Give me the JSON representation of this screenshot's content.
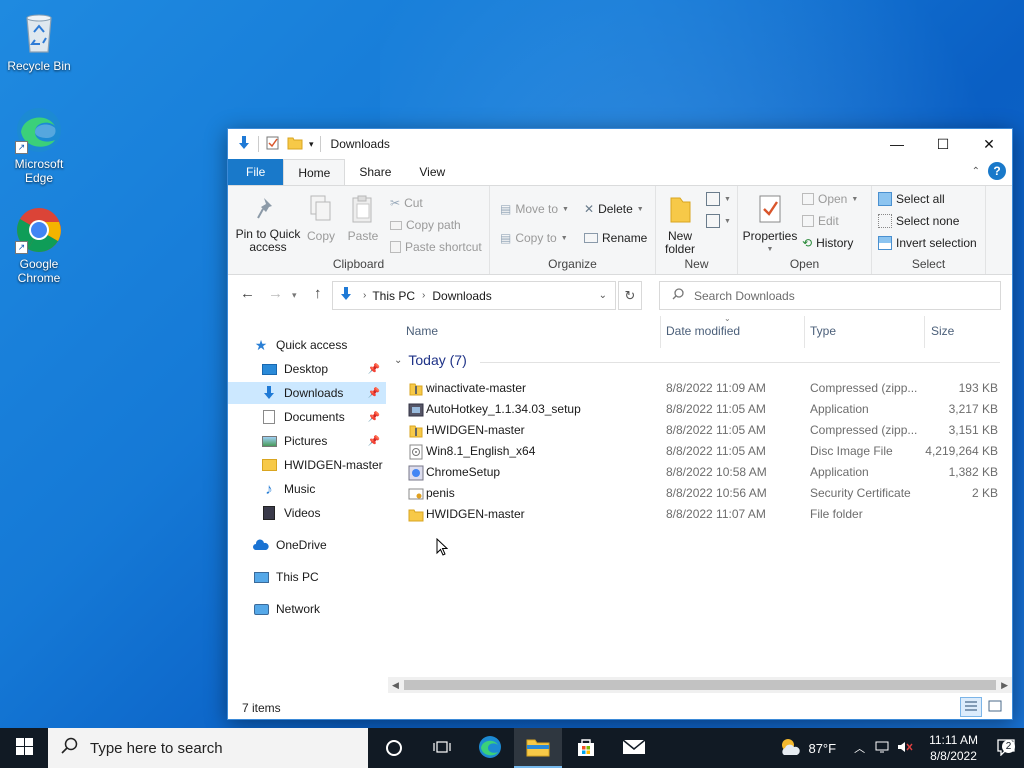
{
  "desktop": {
    "icons": [
      {
        "label": "Recycle Bin"
      },
      {
        "label": "Microsoft Edge"
      },
      {
        "label": "Google Chrome"
      }
    ]
  },
  "window": {
    "title": "Downloads",
    "tabs": {
      "file": "File",
      "home": "Home",
      "share": "Share",
      "view": "View"
    },
    "ribbon": {
      "clipboard": {
        "label": "Clipboard",
        "pin": "Pin to Quick access",
        "copy": "Copy",
        "paste": "Paste",
        "cut": "Cut",
        "copy_path": "Copy path",
        "paste_shortcut": "Paste shortcut"
      },
      "organize": {
        "label": "Organize",
        "move_to": "Move to",
        "copy_to": "Copy to",
        "delete": "Delete",
        "rename": "Rename"
      },
      "new": {
        "label": "New",
        "new_folder": "New folder"
      },
      "open": {
        "label": "Open",
        "properties": "Properties",
        "open": "Open",
        "edit": "Edit",
        "history": "History"
      },
      "select": {
        "label": "Select",
        "select_all": "Select all",
        "select_none": "Select none",
        "invert": "Invert selection"
      }
    },
    "address": {
      "this_pc": "This PC",
      "downloads": "Downloads"
    },
    "search": {
      "placeholder": "Search Downloads"
    },
    "nav": {
      "quick_access": "Quick access",
      "desktop": "Desktop",
      "downloads": "Downloads",
      "documents": "Documents",
      "pictures": "Pictures",
      "hwidgen": "HWIDGEN-master",
      "music": "Music",
      "videos": "Videos",
      "onedrive": "OneDrive",
      "this_pc": "This PC",
      "network": "Network"
    },
    "columns": {
      "name": "Name",
      "date": "Date modified",
      "type": "Type",
      "size": "Size"
    },
    "group": "Today (7)",
    "files": [
      {
        "name": "winactivate-master",
        "date": "8/8/2022 11:09 AM",
        "type": "Compressed (zipp...",
        "size": "193 KB",
        "icon": "zip-icon"
      },
      {
        "name": "AutoHotkey_1.1.34.03_setup",
        "date": "8/8/2022 11:05 AM",
        "type": "Application",
        "size": "3,217 KB",
        "icon": "app-icon"
      },
      {
        "name": "HWIDGEN-master",
        "date": "8/8/2022 11:05 AM",
        "type": "Compressed (zipp...",
        "size": "3,151 KB",
        "icon": "zip-icon"
      },
      {
        "name": "Win8.1_English_x64",
        "date": "8/8/2022 11:05 AM",
        "type": "Disc Image File",
        "size": "4,219,264 KB",
        "icon": "disc-icon"
      },
      {
        "name": "ChromeSetup",
        "date": "8/8/2022 10:58 AM",
        "type": "Application",
        "size": "1,382 KB",
        "icon": "setup-icon"
      },
      {
        "name": "penis",
        "date": "8/8/2022 10:56 AM",
        "type": "Security Certificate",
        "size": "2 KB",
        "icon": "certificate-icon"
      },
      {
        "name": "HWIDGEN-master",
        "date": "8/8/2022 11:07 AM",
        "type": "File folder",
        "size": "",
        "icon": "folder-icon"
      }
    ],
    "status": "7 items"
  },
  "taskbar": {
    "search_placeholder": "Type here to search",
    "weather": "87°F",
    "time": "11:11 AM",
    "date": "8/8/2022",
    "notifications": "2"
  }
}
